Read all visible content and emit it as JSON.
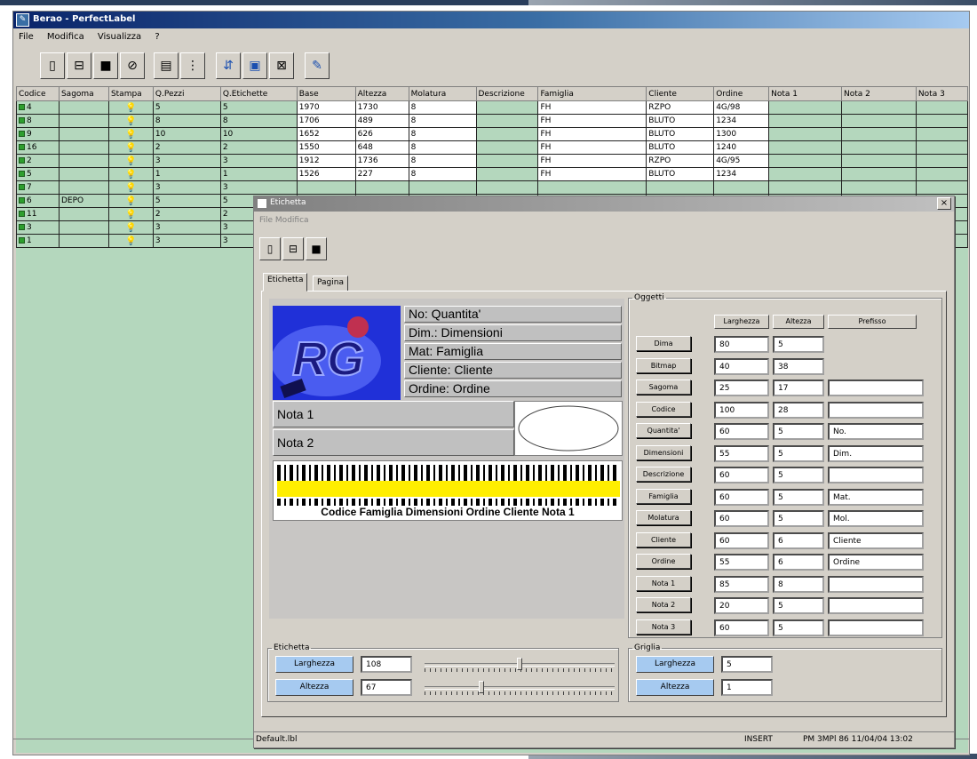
{
  "window": {
    "title": "Berao - PerfectLabel",
    "icon": "app-icon"
  },
  "menu": [
    "File",
    "Modifica",
    "Visualizza",
    "?"
  ],
  "toolbar_icons": [
    "new-icon",
    "open-icon",
    "save-icon",
    "print-icon",
    "layout-icon",
    "label-icon",
    "import-icon",
    "view-icon",
    "export-icon",
    "edit-icon"
  ],
  "grid": {
    "columns": [
      "Codice",
      "Sagoma",
      "Stampa",
      "Q.Pezzi",
      "Q.Etichette",
      "Base",
      "Altezza",
      "Molatura",
      "Descrizione",
      "Famiglia",
      "Cliente",
      "Ordine",
      "Nota 1",
      "Nota 2",
      "Nota 3"
    ],
    "rows": [
      [
        "4",
        "",
        "",
        "5",
        "5",
        "1970",
        "1730",
        "8",
        "",
        "FH",
        "RZPO",
        "4G/98",
        "",
        "",
        ""
      ],
      [
        "8",
        "",
        "",
        "8",
        "8",
        "1706",
        "489",
        "8",
        "",
        "FH",
        "BLUTO",
        "1234",
        "",
        "",
        ""
      ],
      [
        "9",
        "",
        "",
        "10",
        "10",
        "1652",
        "626",
        "8",
        "",
        "FH",
        "BLUTO",
        "1300",
        "",
        "",
        ""
      ],
      [
        "16",
        "",
        "",
        "2",
        "2",
        "1550",
        "648",
        "8",
        "",
        "FH",
        "BLUTO",
        "1240",
        "",
        "",
        ""
      ],
      [
        "2",
        "",
        "",
        "3",
        "3",
        "1912",
        "1736",
        "8",
        "",
        "FH",
        "RZPO",
        "4G/95",
        "",
        "",
        ""
      ],
      [
        "5",
        "",
        "",
        "1",
        "1",
        "1526",
        "227",
        "8",
        "",
        "FH",
        "BLUTO",
        "1234",
        "",
        "",
        ""
      ],
      [
        "7",
        "",
        "",
        "3",
        "3",
        "",
        "",
        "",
        "",
        "",
        "",
        "",
        "",
        "",
        ""
      ],
      [
        "6",
        "DEPO",
        "",
        "5",
        "5",
        "",
        "",
        "",
        "",
        "",
        "",
        "",
        "",
        "",
        ""
      ],
      [
        "11",
        "",
        "",
        "2",
        "2",
        "",
        "",
        "",
        "",
        "",
        "",
        "",
        "",
        "",
        ""
      ],
      [
        "3",
        "",
        "",
        "3",
        "3",
        "",
        "",
        "",
        "",
        "",
        "",
        "",
        "",
        "",
        ""
      ],
      [
        "1",
        "",
        "",
        "3",
        "3",
        "",
        "",
        "",
        "",
        "",
        "",
        "",
        "",
        "",
        ""
      ]
    ]
  },
  "dialog": {
    "title": "Etichetta",
    "menu": "File Modifica",
    "tabs": [
      "Etichetta",
      "Pagina"
    ],
    "label_rows": [
      "No: Quantita'",
      "Dim.: Dimensioni",
      "Mat: Famiglia",
      "Cliente: Cliente",
      "Ordine: Ordine"
    ],
    "nota1": "Nota 1",
    "nota2": "Nota 2",
    "barcode_text": "Codice Famiglia Dimensioni Ordine Cliente Nota 1",
    "oggetti": {
      "legend": "Oggetti",
      "headers": [
        "Larghezza",
        "Altezza",
        "Prefisso"
      ],
      "rows": [
        {
          "name": "Dima",
          "w": "80",
          "h": "5",
          "prefix": null
        },
        {
          "name": "Bitmap",
          "w": "40",
          "h": "38",
          "prefix": null
        },
        {
          "name": "Sagoma",
          "w": "25",
          "h": "17",
          "prefix": ""
        },
        {
          "name": "Codice",
          "w": "100",
          "h": "28",
          "prefix": ""
        },
        {
          "name": "Quantita'",
          "w": "60",
          "h": "5",
          "prefix": "No."
        },
        {
          "name": "Dimensioni",
          "w": "55",
          "h": "5",
          "prefix": "Dim."
        },
        {
          "name": "Descrizione",
          "w": "60",
          "h": "5",
          "prefix": ""
        },
        {
          "name": "Famiglia",
          "w": "60",
          "h": "5",
          "prefix": "Mat."
        },
        {
          "name": "Molatura",
          "w": "60",
          "h": "5",
          "prefix": "Mol."
        },
        {
          "name": "Cliente",
          "w": "60",
          "h": "6",
          "prefix": "Cliente"
        },
        {
          "name": "Ordine",
          "w": "55",
          "h": "6",
          "prefix": "Ordine"
        },
        {
          "name": "Nota 1",
          "w": "85",
          "h": "8",
          "prefix": ""
        },
        {
          "name": "Nota 2",
          "w": "20",
          "h": "5",
          "prefix": ""
        },
        {
          "name": "Nota 3",
          "w": "60",
          "h": "5",
          "prefix": ""
        }
      ]
    },
    "etichetta": {
      "legend": "Etichetta",
      "larghezza_label": "Larghezza",
      "larghezza": "108",
      "altezza_label": "Altezza",
      "altezza": "67",
      "larghezza_slider": 0.5,
      "altezza_slider": 0.3
    },
    "griglia": {
      "legend": "Griglia",
      "larghezza_label": "Larghezza",
      "larghezza": "5",
      "altezza_label": "Altezza",
      "altezza": "1"
    }
  },
  "status": {
    "left": "Default.lbl",
    "mode": "INSERT",
    "right": "PM 3MPl 86 11/04/04 13:02"
  }
}
